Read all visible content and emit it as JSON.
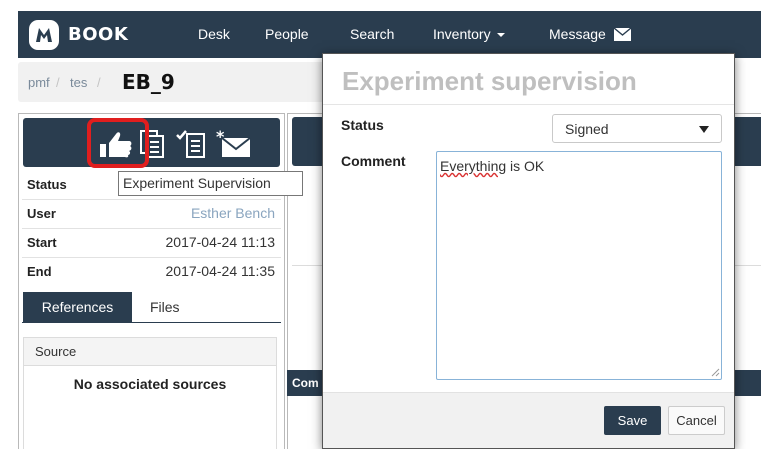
{
  "navbar": {
    "logo_text": "BOOK",
    "links": {
      "desk": "Desk",
      "people": "People",
      "search": "Search",
      "inventory": "Inventory",
      "message": "Message"
    }
  },
  "breadcrumb": {
    "items": [
      "pmf",
      "tes"
    ],
    "current": "EB_9"
  },
  "experiment": {
    "toolbar_icons": [
      "thumbs-up-icon",
      "document-list-icon",
      "checklist-icon",
      "mail-star-icon"
    ],
    "tooltip": "Experiment Supervision",
    "properties": {
      "status_label": "Status",
      "user_label": "User",
      "user_value": "Esther Bench",
      "start_label": "Start",
      "start_value": "2017-04-24 11:13",
      "end_label": "End",
      "end_value": "2017-04-24 11:35"
    },
    "tabs": {
      "references": "References",
      "files": "Files"
    },
    "source": {
      "header": "Source",
      "empty_text": "No associated sources"
    }
  },
  "background": {
    "strip_label": "Com"
  },
  "modal": {
    "title": "Experiment supervision",
    "status_label": "Status",
    "status_value": "Signed",
    "comment_label": "Comment",
    "comment_word_1": "Everything",
    "comment_word_rest": " is OK",
    "save_label": "Save",
    "cancel_label": "Cancel"
  },
  "colors": {
    "navbar": "#2a3d4f",
    "highlight": "#e01e1e",
    "link": "#8aa5bf",
    "modal_title": "#bfbfbf"
  }
}
